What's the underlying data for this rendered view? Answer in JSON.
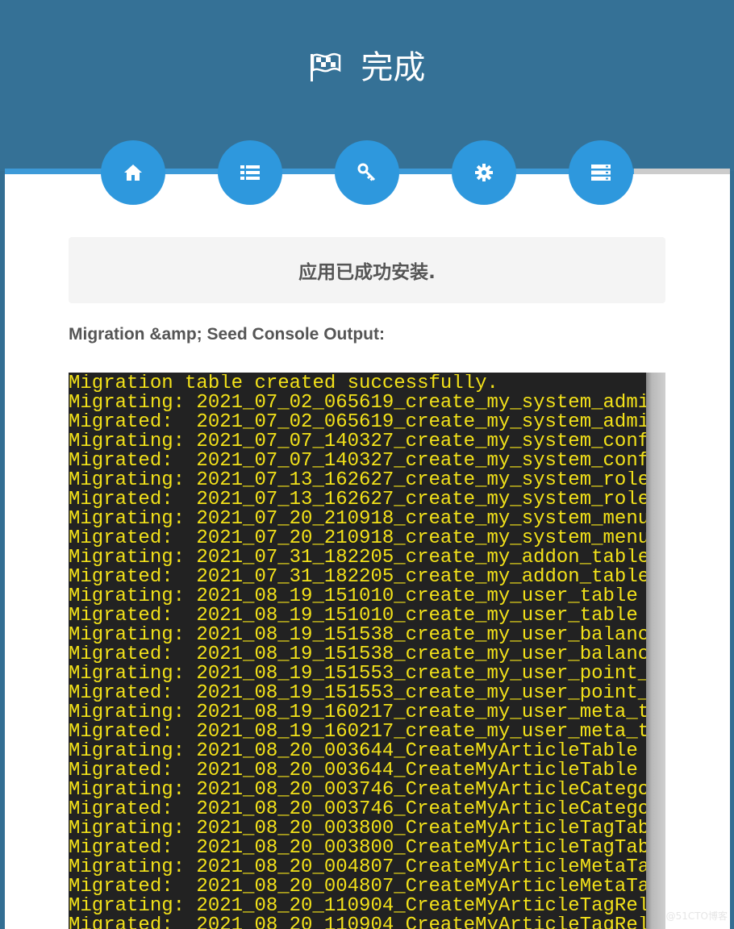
{
  "header": {
    "title": "完成",
    "icon": "flag-checkered-icon"
  },
  "steps": [
    {
      "name": "home",
      "icon": "home-icon"
    },
    {
      "name": "list",
      "icon": "list-icon"
    },
    {
      "name": "key",
      "icon": "key-icon"
    },
    {
      "name": "settings",
      "icon": "gear-icon"
    },
    {
      "name": "database",
      "icon": "server-icon"
    }
  ],
  "notice": {
    "text": "应用已成功安装."
  },
  "console": {
    "label": "Migration &amp; Seed Console Output:",
    "lines": [
      "Migration table created successfully.",
      "Migrating: 2021_07_02_065619_create_my_system_admi",
      "Migrated:  2021_07_02_065619_create_my_system_admi",
      "Migrating: 2021_07_07_140327_create_my_system_conf",
      "Migrated:  2021_07_07_140327_create_my_system_conf",
      "Migrating: 2021_07_13_162627_create_my_system_role",
      "Migrated:  2021_07_13_162627_create_my_system_role",
      "Migrating: 2021_07_20_210918_create_my_system_menu",
      "Migrated:  2021_07_20_210918_create_my_system_menu",
      "Migrating: 2021_07_31_182205_create_my_addon_table",
      "Migrated:  2021_07_31_182205_create_my_addon_table",
      "Migrating: 2021_08_19_151010_create_my_user_table ",
      "Migrated:  2021_08_19_151010_create_my_user_table ",
      "Migrating: 2021_08_19_151538_create_my_user_balanc",
      "Migrated:  2021_08_19_151538_create_my_user_balanc",
      "Migrating: 2021_08_19_151553_create_my_user_point_",
      "Migrated:  2021_08_19_151553_create_my_user_point_",
      "Migrating: 2021_08_19_160217_create_my_user_meta_t",
      "Migrated:  2021_08_19_160217_create_my_user_meta_t",
      "Migrating: 2021_08_20_003644_CreateMyArticleTable ",
      "Migrated:  2021_08_20_003644_CreateMyArticleTable ",
      "Migrating: 2021_08_20_003746_CreateMyArticleCatego",
      "Migrated:  2021_08_20_003746_CreateMyArticleCatego",
      "Migrating: 2021_08_20_003800_CreateMyArticleTagTab",
      "Migrated:  2021_08_20_003800_CreateMyArticleTagTab",
      "Migrating: 2021_08_20_004807_CreateMyArticleMetaTa",
      "Migrated:  2021_08_20_004807_CreateMyArticleMetaTa",
      "Migrating: 2021_08_20_110904_CreateMyArticleTagRel",
      "Migrated:  2021_08_20_110904_CreateMyArticleTagRel"
    ]
  },
  "watermark": "@51CTO博客",
  "colors": {
    "header": "#357196",
    "accent": "#2e98dd",
    "console_bg": "#222222",
    "console_text": "#f2e11a"
  }
}
